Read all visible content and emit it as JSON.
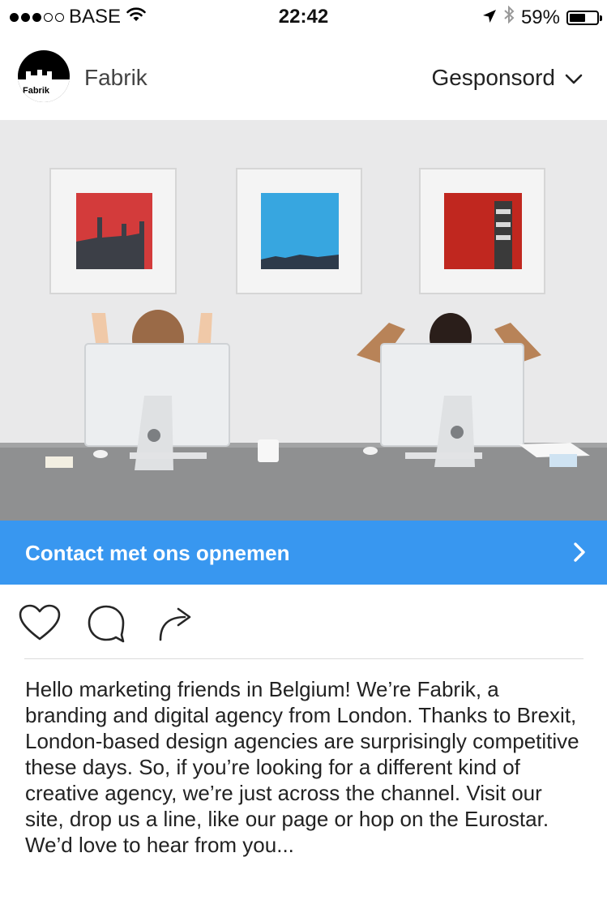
{
  "status_bar": {
    "carrier": "BASE",
    "time": "22:42",
    "battery_pct": "59%",
    "battery_level": 0.59,
    "signal_bars_filled": 3,
    "signal_bars_total": 5
  },
  "post": {
    "account_name": "Fabrik",
    "avatar_logo_text": "Fabrik",
    "sponsored_label": "Gesponsord",
    "cta_label": "Contact met ons opnemen",
    "caption": "Hello marketing friends in Belgium! We’re Fabrik, a branding and digital agency from London. Thanks to Brexit, London-based design agencies are surprisingly competitive these days. So, if you’re looking for a different kind of creative agency, we’re just across the channel. Visit our site, drop us a line, like our page or hop on the Eurostar. We’d love to hear from you..."
  },
  "icons": [
    "signal-dots-icon",
    "wifi-icon",
    "location-arrow-icon",
    "bluetooth-icon",
    "battery-icon",
    "chevron-down-icon",
    "chevron-right-icon",
    "heart-icon",
    "comment-icon",
    "share-icon"
  ],
  "colors": {
    "cta_blue": "#3897f0",
    "divider": "#dbdbdb"
  }
}
